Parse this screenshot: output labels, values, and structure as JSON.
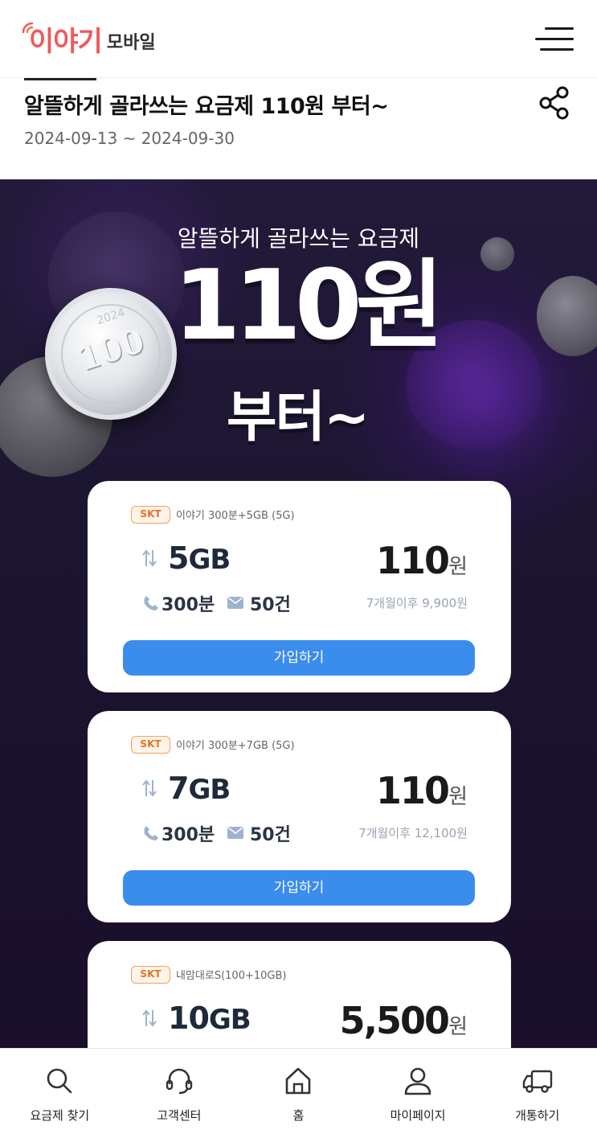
{
  "header": {
    "logo_brand": "이야기",
    "logo_sub": "모바일"
  },
  "event": {
    "title": "알뜰하게 골라쓰는 요금제 110원 부터~",
    "date": "2024-09-13 ~ 2024-09-30"
  },
  "banner": {
    "subtitle": "알뜰하게 골라쓰는 요금제",
    "price": "110원",
    "from": "부터~",
    "coin_value": "100",
    "coin_year": "2024"
  },
  "plans": [
    {
      "carrier": "SKT",
      "name": "이야기 300분+5GB (5G)",
      "data_num": "5",
      "data_unit": "GB",
      "price_num": "110",
      "price_unit": "원",
      "calls": "300분",
      "sms": "50건",
      "after_price": "7개월이후 9,900원",
      "button": "가입하기"
    },
    {
      "carrier": "SKT",
      "name": "이야기 300분+7GB (5G)",
      "data_num": "7",
      "data_unit": "GB",
      "price_num": "110",
      "price_unit": "원",
      "calls": "300분",
      "sms": "50건",
      "after_price": "7개월이후 12,100원",
      "button": "가입하기"
    },
    {
      "carrier": "SKT",
      "name": "내맘대로S(100+10GB)",
      "data_num": "10",
      "data_unit": "GB",
      "price_num": "5,500",
      "price_unit": "원"
    }
  ],
  "nav": [
    {
      "label": "요금제 찾기",
      "icon": "search-icon"
    },
    {
      "label": "고객센터",
      "icon": "headset-icon"
    },
    {
      "label": "홈",
      "icon": "home-icon"
    },
    {
      "label": "마이페이지",
      "icon": "user-icon"
    },
    {
      "label": "개통하기",
      "icon": "truck-icon"
    }
  ],
  "colors": {
    "brand": "#ef5a5d",
    "button": "#3b8ded",
    "banner_bg": "#1f1f22",
    "badge_border": "#f2a05a"
  }
}
